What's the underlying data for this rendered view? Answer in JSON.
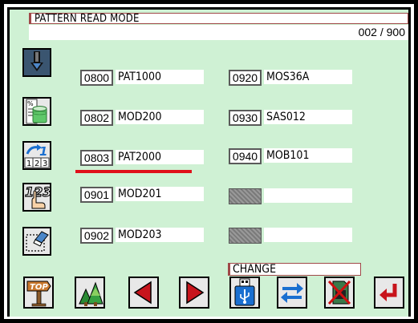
{
  "screen": {
    "title": "PATTERN READ MODE",
    "counter": "002 / 900"
  },
  "sidebar": {
    "items": [
      {
        "name": "download-needle-icon"
      },
      {
        "name": "database-percent-icon"
      },
      {
        "name": "renumber-icon"
      },
      {
        "name": "keypad-hand-icon"
      },
      {
        "name": "eraser-icon"
      }
    ]
  },
  "patterns": {
    "left": [
      {
        "number": "0800",
        "name": "PAT1000"
      },
      {
        "number": "0802",
        "name": "MOD200"
      },
      {
        "number": "0803",
        "name": "PAT2000"
      },
      {
        "number": "0901",
        "name": "MOD201"
      },
      {
        "number": "0902",
        "name": "MOD203"
      }
    ],
    "right": [
      {
        "number": "0920",
        "name": "MOS36A"
      },
      {
        "number": "0930",
        "name": "SAS012"
      },
      {
        "number": "0940",
        "name": "MOB101"
      },
      {
        "number": "",
        "name": ""
      },
      {
        "number": "",
        "name": ""
      }
    ],
    "selected": "0803"
  },
  "bottom": {
    "change_label": "CHANGE",
    "buttons": [
      {
        "name": "top-signpost-icon",
        "label": "TOP"
      },
      {
        "name": "trees-icon"
      },
      {
        "name": "arrow-left-icon"
      },
      {
        "name": "arrow-right-icon"
      },
      {
        "name": "usb-icon"
      },
      {
        "name": "swap-arrows-icon"
      },
      {
        "name": "card-disabled-icon"
      },
      {
        "name": "enter-return-icon"
      }
    ]
  },
  "colors": {
    "background": "#cff1d4",
    "highlight_underline": "#e0101a",
    "arrow_red": "#c8141c",
    "arrow_blue": "#1a6fd0"
  }
}
